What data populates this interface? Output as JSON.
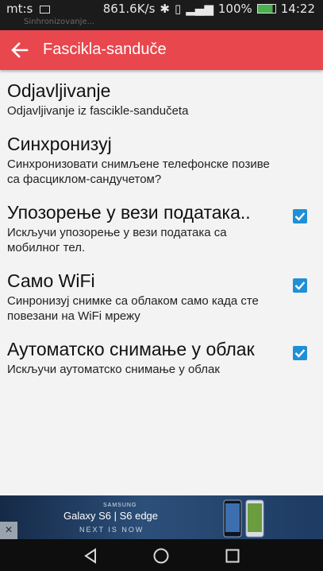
{
  "status_bar": {
    "carrier": "mt:s",
    "speed": "861.6K/s",
    "battery": "100%",
    "time": "14:22",
    "notification_text": "Sinhronizovanje..."
  },
  "app_bar": {
    "title": "Fascikla-sanduče",
    "back_icon": "arrow-left-icon"
  },
  "colors": {
    "app_bar": "#e8474e",
    "checkbox": "#1f8fd6",
    "background": "#f3f3f3"
  },
  "settings": [
    {
      "title": "Odjavljivanje",
      "summary": "Odjavljivanje iz fascikle-sandučeta",
      "checked": null
    },
    {
      "title": "Синхронизуј",
      "summary": "Синхронизовати снимљене телефонске позиве са фасциклом-сандучетом?",
      "checked": null
    },
    {
      "title": "Упозорење у вези података..",
      "summary": "Искључи упозорење у вези података са мобилног тел.",
      "checked": true
    },
    {
      "title": "Само WiFi",
      "summary": "Синронизуј снимке са облаком само када сте повезани на WiFi мрежу",
      "checked": true
    },
    {
      "title": "Аутоматско снимање у облак",
      "summary": "Искључи аутоматско снимање у облак",
      "checked": true
    }
  ],
  "ad": {
    "brand": "SAMSUNG",
    "product": "Galaxy S6 | S6 edge",
    "cta": "NEXT IS NOW",
    "close_label": "×"
  },
  "nav": {
    "back_icon": "triangle-back-icon",
    "home_icon": "circle-home-icon",
    "recents_icon": "square-recents-icon"
  }
}
